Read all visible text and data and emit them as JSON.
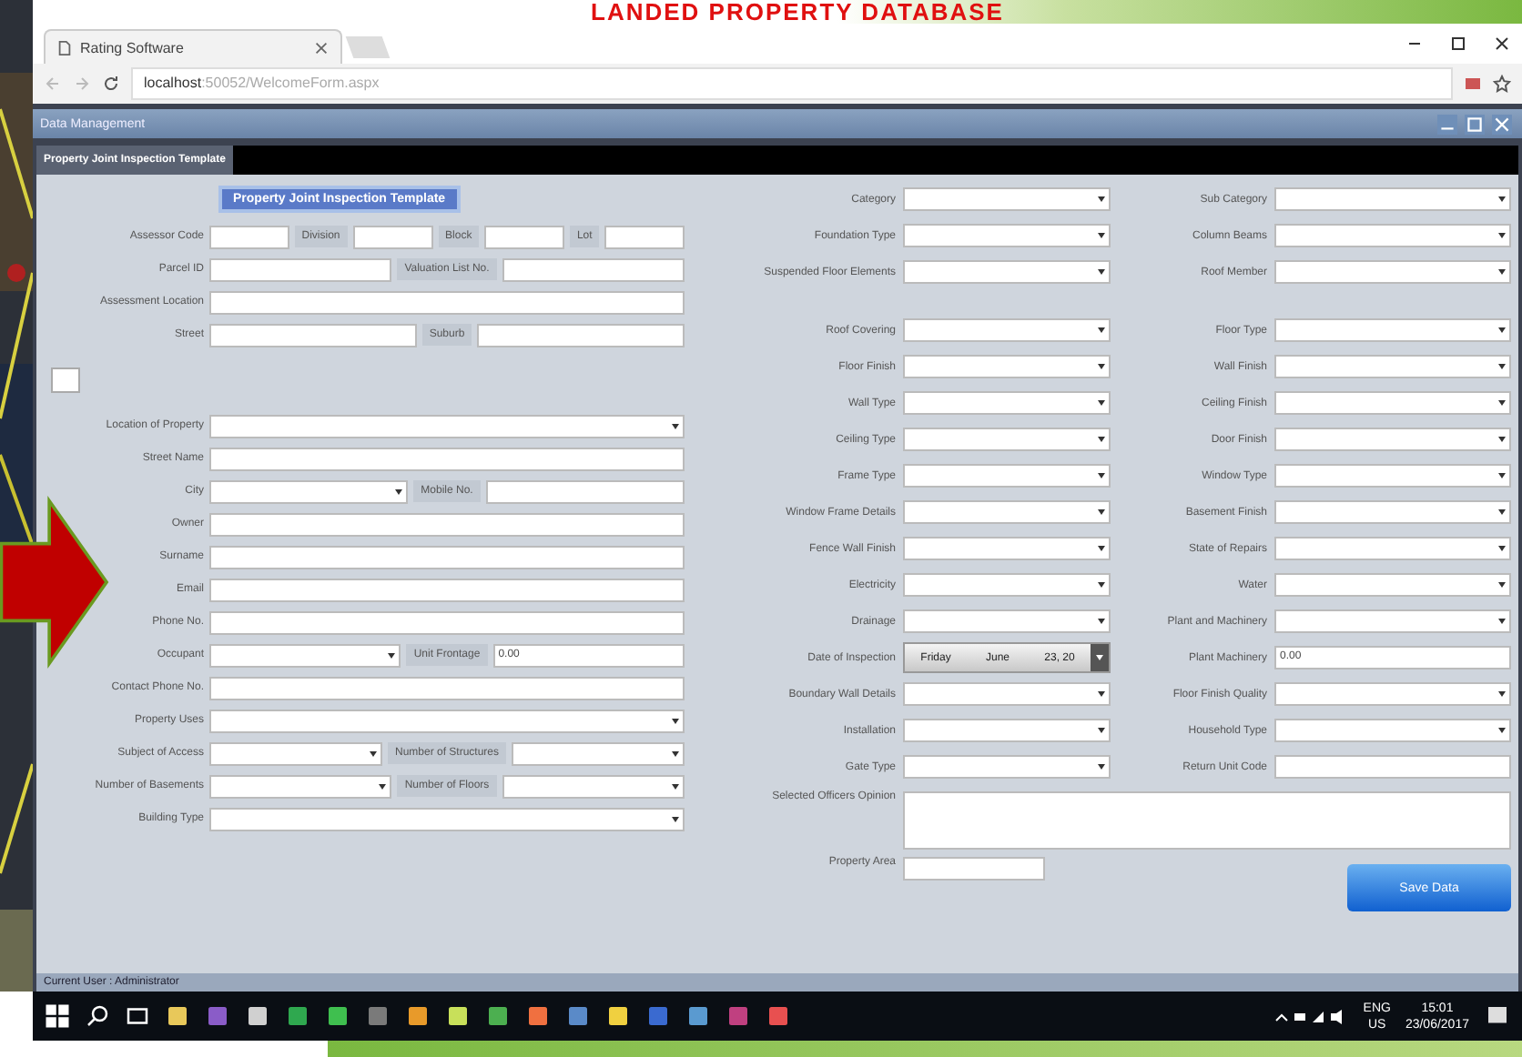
{
  "slide": {
    "title": "LANDED PROPERTY DATABASE"
  },
  "browser": {
    "tab": "Rating Software",
    "address_host": "localhost",
    "address_path": ":50052/WelcomeForm.aspx"
  },
  "app": {
    "title": "Data Management",
    "tabs": [
      {
        "label": "Property Joint Inspection Template",
        "selected": true
      }
    ],
    "heading": "Property Joint Inspection Template"
  },
  "left_rows": [
    {
      "kind": "fields",
      "items": [
        {
          "label": "Assessor Code",
          "kind": "input"
        },
        {
          "label": "Division",
          "kind": "input"
        },
        {
          "label": "Block",
          "kind": "input"
        },
        {
          "label": "Lot",
          "kind": "input"
        }
      ]
    },
    {
      "kind": "fields",
      "items": [
        {
          "label": "Parcel ID",
          "kind": "input"
        },
        {
          "label": "Valuation List No.",
          "kind": "input"
        }
      ]
    },
    {
      "kind": "fields",
      "items": [
        {
          "label": "Assessment Location",
          "kind": "input"
        }
      ]
    },
    {
      "kind": "fields",
      "items": [
        {
          "label": "Street",
          "kind": "input"
        },
        {
          "label": "Suburb",
          "kind": "input"
        }
      ]
    },
    {
      "kind": "checkbox",
      "checked": false
    },
    {
      "kind": "fields",
      "items": [
        {
          "label": "Location of Property",
          "kind": "select"
        }
      ]
    },
    {
      "kind": "fields",
      "items": [
        {
          "label": "Street Name",
          "kind": "input"
        }
      ]
    },
    {
      "kind": "fields",
      "items": [
        {
          "label": "City",
          "kind": "select"
        },
        {
          "label": "Mobile No.",
          "kind": "input"
        }
      ]
    },
    {
      "kind": "fields",
      "items": [
        {
          "label": "Owner",
          "kind": "input"
        }
      ]
    },
    {
      "kind": "fields",
      "items": [
        {
          "label": "Surname",
          "kind": "input"
        }
      ]
    },
    {
      "kind": "fields",
      "items": [
        {
          "label": "Email",
          "kind": "input"
        }
      ]
    },
    {
      "kind": "fields",
      "items": [
        {
          "label": "Phone No.",
          "kind": "input"
        }
      ]
    },
    {
      "kind": "fields",
      "items": [
        {
          "label": "Occupant",
          "kind": "select"
        },
        {
          "label": "Unit Frontage",
          "kind": "input",
          "value": "0.00"
        }
      ]
    },
    {
      "kind": "fields",
      "items": [
        {
          "label": "Contact Phone No.",
          "kind": "input"
        }
      ]
    },
    {
      "kind": "fields",
      "items": [
        {
          "label": "Property Uses",
          "kind": "select"
        }
      ]
    },
    {
      "kind": "fields",
      "items": [
        {
          "label": "Subject of Access",
          "kind": "select"
        },
        {
          "label": "Number of Structures",
          "kind": "select"
        }
      ]
    },
    {
      "kind": "fields",
      "items": [
        {
          "label": "Number of Basements",
          "kind": "select"
        },
        {
          "label": "Number of Floors",
          "kind": "select"
        }
      ]
    },
    {
      "kind": "fields",
      "items": [
        {
          "label": "Building Type",
          "kind": "select"
        }
      ]
    }
  ],
  "middle_fields": [
    {
      "label": "Category",
      "kind": "select"
    },
    {
      "label": "Foundation Type",
      "kind": "select"
    },
    {
      "label": "Suspended Floor Elements",
      "kind": "select"
    },
    {
      "label": "Roof Covering",
      "kind": "select"
    },
    {
      "label": "Floor Finish",
      "kind": "select"
    },
    {
      "label": "Wall Type",
      "kind": "select"
    },
    {
      "label": "Ceiling Type",
      "kind": "select"
    },
    {
      "label": "Frame Type",
      "kind": "select"
    },
    {
      "label": "Window Frame Details",
      "kind": "select"
    },
    {
      "label": "Fence Wall Finish",
      "kind": "select"
    },
    {
      "label": "Electricity",
      "kind": "select"
    },
    {
      "label": "Drainage",
      "kind": "select"
    },
    {
      "label": "Date of Inspection",
      "kind": "date",
      "parts": [
        "Friday",
        "June",
        "23, 20"
      ]
    },
    {
      "label": "Boundary Wall Details",
      "kind": "select"
    },
    {
      "label": "Installation",
      "kind": "select"
    },
    {
      "label": "Gate Type",
      "kind": "select"
    }
  ],
  "right_fields": [
    {
      "label": "Sub Category",
      "kind": "select"
    },
    {
      "label": "Column Beams",
      "kind": "select"
    },
    {
      "label": "Roof Member",
      "kind": "select"
    },
    {
      "label": "Floor Type",
      "kind": "select"
    },
    {
      "label": "Wall Finish",
      "kind": "select"
    },
    {
      "label": "Ceiling Finish",
      "kind": "select"
    },
    {
      "label": "Door Finish",
      "kind": "select"
    },
    {
      "label": "Window Type",
      "kind": "select"
    },
    {
      "label": "Basement Finish",
      "kind": "select"
    },
    {
      "label": "State of Repairs",
      "kind": "select"
    },
    {
      "label": "Water",
      "kind": "select"
    },
    {
      "label": "Plant and Machinery",
      "kind": "select"
    },
    {
      "label": "Plant Machinery",
      "kind": "input",
      "value": "0.00"
    },
    {
      "label": "Floor Finish Quality",
      "kind": "select"
    },
    {
      "label": "Household Type",
      "kind": "select"
    },
    {
      "label": "Return Unit Code",
      "kind": "input"
    }
  ],
  "opinion": {
    "label": "Selected Officers Opinion"
  },
  "property_area": {
    "label": "Property Area"
  },
  "save_button": "Save Data",
  "status_bar": "Current User : Administrator",
  "taskbar": {
    "lang": "ENG",
    "region": "US",
    "time": "15:01",
    "date": "23/06/2017"
  }
}
